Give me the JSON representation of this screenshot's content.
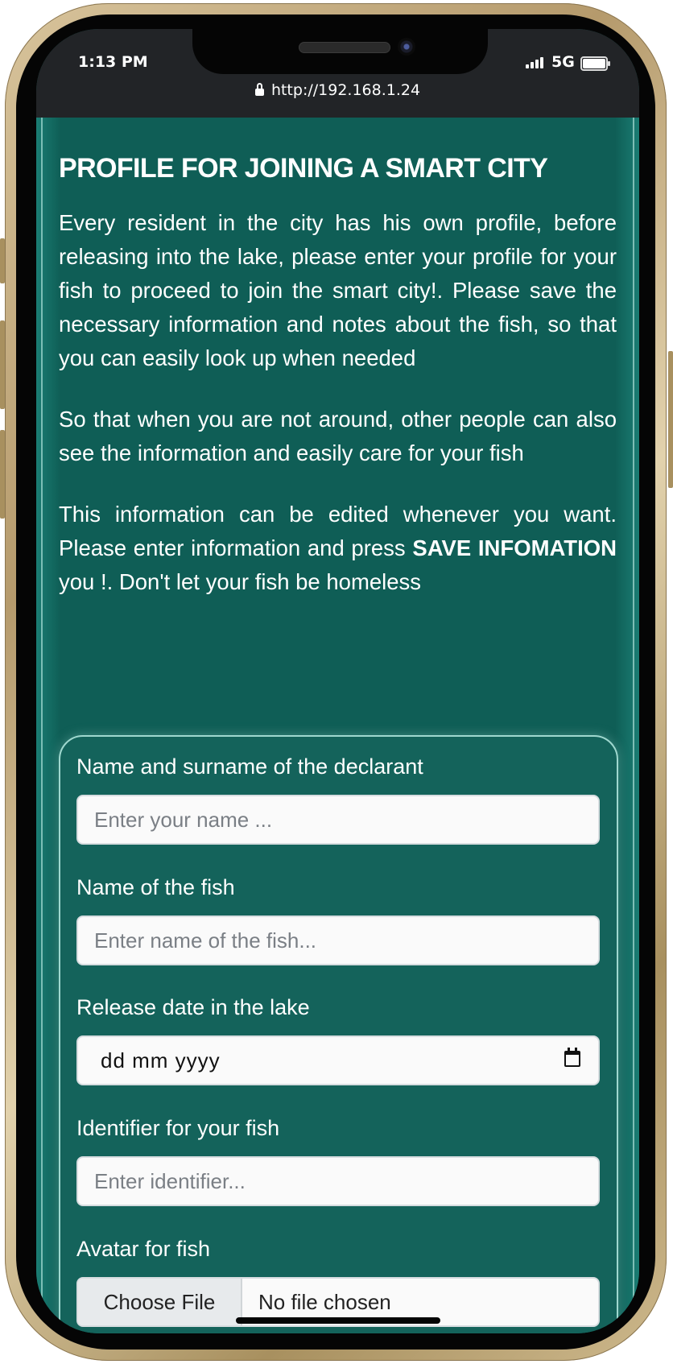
{
  "status_bar": {
    "time": "1:13 PM",
    "network": "5G",
    "url": "http://192.168.1.24",
    "icons": [
      "signal-icon",
      "battery-icon",
      "lock-icon"
    ]
  },
  "page": {
    "title": "PROFILE FOR JOINING A SMART CITY",
    "paragraph1": "Every resident in the city has his own profile, before releasing into the lake, please enter your profile for your fish to proceed to join the smart city!. Please save the necessary information and notes about the fish, so that you can easily look up when needed",
    "paragraph2": "So that when you are not around, other people can also see the information and easily care for your fish",
    "paragraph3_before": "This information can be edited whenever you want. Please enter information and press ",
    "paragraph3_bold": "SAVE INFOMATION",
    "paragraph3_after": " you !. Don't let your fish be homeless"
  },
  "form": {
    "declarant_label": "Name and surname of the declarant",
    "declarant_placeholder": "Enter your name ...",
    "fish_name_label": "Name of the fish",
    "fish_name_placeholder": "Enter name of the fish...",
    "release_date_label": "Release date in the lake",
    "release_date_value": "dd  mm  yyyy",
    "identifier_label": "Identifier for your fish",
    "identifier_placeholder": "Enter identifier...",
    "avatar_label": "Avatar for fish",
    "file_button": "Choose File",
    "file_status": "No file chosen"
  },
  "colors": {
    "page_background": "#0f5e56",
    "form_border": "#9fd8cf",
    "status_bar": "#222427"
  }
}
